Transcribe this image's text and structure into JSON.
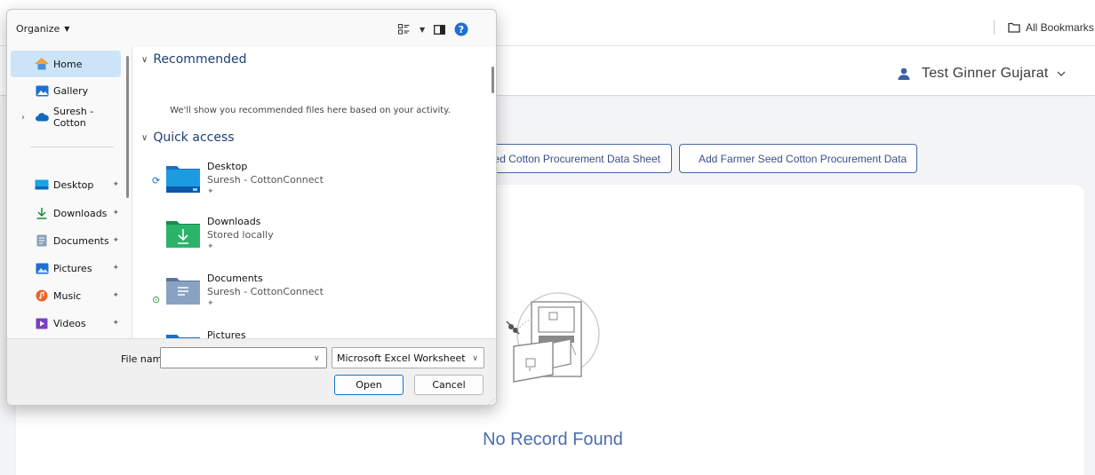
{
  "browser": {
    "all_bookmarks": "All Bookmarks"
  },
  "app": {
    "user_name": "Test Ginner Gujarat",
    "buttons": {
      "sheet": "eed Cotton Procurement Data Sheet",
      "add": "Add Farmer Seed Cotton Procurement Data"
    },
    "empty_message": "No Record Found"
  },
  "dialog": {
    "toolbar": {
      "organize": "Organize"
    },
    "nav": {
      "items": [
        {
          "label": "Home",
          "icon": "home-icon"
        },
        {
          "label": "Gallery",
          "icon": "gallery-icon"
        },
        {
          "label": "Suresh - Cotton",
          "icon": "onedrive-cloud-icon"
        },
        {
          "label": "Desktop",
          "icon": "desktop-icon"
        },
        {
          "label": "Downloads",
          "icon": "download-icon"
        },
        {
          "label": "Documents",
          "icon": "documents-icon"
        },
        {
          "label": "Pictures",
          "icon": "pictures-icon"
        },
        {
          "label": "Music",
          "icon": "music-icon"
        },
        {
          "label": "Videos",
          "icon": "videos-icon"
        }
      ]
    },
    "recommended": {
      "title": "Recommended",
      "note": "We'll show you recommended files here based on your activity."
    },
    "quick_access": {
      "title": "Quick access",
      "items": [
        {
          "name": "Desktop",
          "location": "Suresh - CottonConnect"
        },
        {
          "name": "Downloads",
          "location": "Stored locally"
        },
        {
          "name": "Documents",
          "location": "Suresh - CottonConnect"
        },
        {
          "name": "Pictures",
          "location": ""
        }
      ]
    },
    "footer": {
      "file_name_label": "File name:",
      "file_name_value": "",
      "file_type": "Microsoft Excel Worksheet",
      "open": "Open",
      "cancel": "Cancel"
    }
  },
  "colors": {
    "primary": "#4a6eb3",
    "outline": "#4766a8",
    "selection": "#cce4f7"
  }
}
